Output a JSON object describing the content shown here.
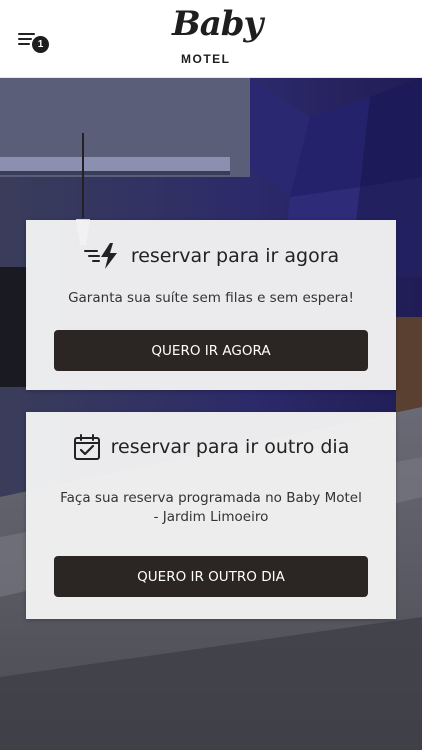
{
  "header": {
    "menu_badge": "1",
    "logo_script": "Baby",
    "logo_sub": "MOTEL"
  },
  "cards": [
    {
      "title": "reservar para ir agora",
      "description": "Garanta sua suíte sem filas e sem espera!",
      "button_label": "QUERO IR AGORA",
      "icon": "fast-bolt-icon"
    },
    {
      "title": "reservar para ir outro dia",
      "description": "Faça sua reserva programada no Baby Motel - Jardim Limoeiro",
      "button_label": "QUERO IR OUTRO DIA",
      "icon": "calendar-check-icon"
    }
  ],
  "colors": {
    "button_bg": "#2b2523",
    "card_bg": "#f2f2f2",
    "header_bg": "#ffffff"
  }
}
